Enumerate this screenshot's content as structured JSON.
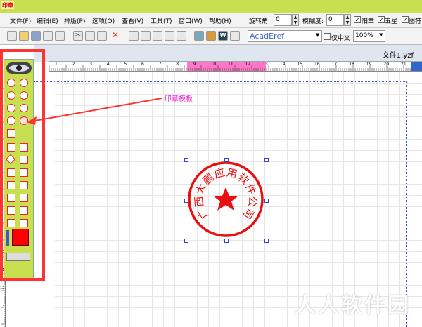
{
  "titlebar": {
    "logo": "印章"
  },
  "menu": [
    {
      "label": "文件(F)"
    },
    {
      "label": "编辑(E)"
    },
    {
      "label": "排版(P)"
    },
    {
      "label": "选项(O)"
    },
    {
      "label": "查看(V)"
    },
    {
      "label": "工具(T)"
    },
    {
      "label": "窗口(W)"
    },
    {
      "label": "帮助(H)"
    }
  ],
  "properties": {
    "rotation_label": "旋转角:",
    "rotation_value": "0",
    "blur_label": "模糊度:",
    "blur_value": "0",
    "checkbox_yang": "阳章",
    "checkbox_star": "五星",
    "checkbox_pattern": "图符"
  },
  "font": {
    "value": "AcadEref",
    "only_chinese": "仅中文",
    "zoom": "100%"
  },
  "document": {
    "tab_title": "文件1.yzf"
  },
  "ruler": {
    "top": [
      "1",
      "2",
      "3",
      "4",
      "5",
      "6",
      "7",
      "8",
      "9",
      "10",
      "11",
      "12",
      "13",
      "14",
      "15",
      "16",
      "17",
      "18",
      "19",
      "20",
      "21"
    ],
    "left": [
      "1",
      "2",
      "3",
      "4",
      "5",
      "6",
      "7",
      "8",
      "9",
      "10",
      "11",
      "12",
      "13"
    ]
  },
  "annotation": {
    "label": "印章模板"
  },
  "stamp": {
    "text": "广西大鹏应用软件公司",
    "color": "#e81010",
    "glyphs": [
      "广",
      "西",
      "大",
      "鹏",
      "应",
      "用",
      "软",
      "件",
      "公",
      "司"
    ]
  },
  "colors": {
    "panel_bg": "#c8e050",
    "accent_red": "#ff3333",
    "selection": "#3344cc",
    "ruler_highlight": "#ff77c8"
  },
  "watermark": "人人软件园"
}
